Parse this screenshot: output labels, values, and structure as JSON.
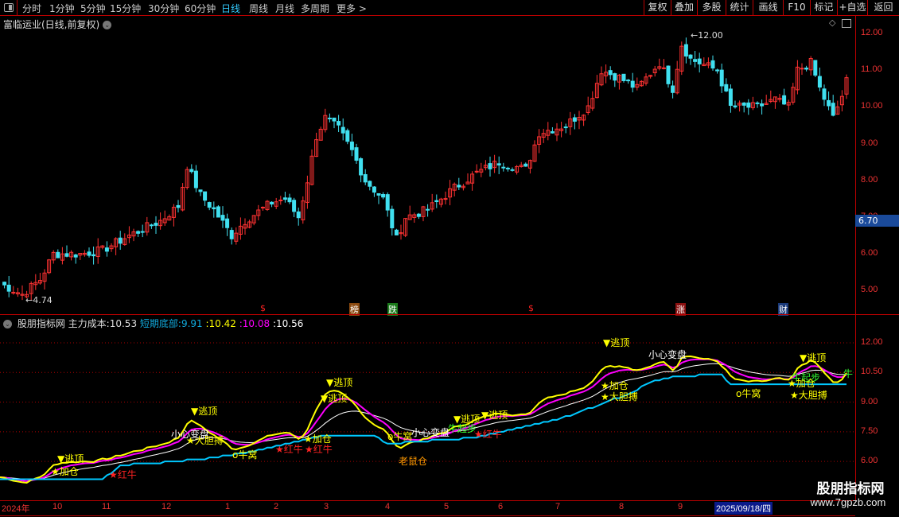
{
  "toolbar": {
    "periods": [
      "分时",
      "1分钟",
      "5分钟",
      "15分钟",
      "30分钟",
      "60分钟",
      "日线",
      "周线",
      "月线",
      "多周期",
      "更多 >"
    ],
    "active_period": "日线",
    "buttons": [
      "复权",
      "叠加",
      "多股",
      "统计",
      "画线",
      "F10",
      "标记",
      "+自选",
      "返回"
    ]
  },
  "main": {
    "title": "富临运业(日线,前复权)",
    "price_ticks": [
      "12.00",
      "11.00",
      "10.00",
      "9.00",
      "8.00",
      "7.00",
      "6.00",
      "5.00"
    ],
    "current_price": "6.70",
    "high_label": "12.00",
    "low_label": "4.74",
    "event_markers": [
      "$",
      "榜",
      "跌",
      "$",
      "涨",
      "财"
    ]
  },
  "indicator": {
    "name": "股朋指标网",
    "main_cost_label": "主力成本:",
    "main_cost": "10.53",
    "short_bottom_label": "短期底部:",
    "short_bottom": "9.91",
    "v_yellow": "10.42",
    "v_magenta": "10.08",
    "v_white": "10.56",
    "ticks": [
      "12.00",
      "10.50",
      "9.00",
      "7.50",
      "6.00"
    ],
    "signals": [
      "▼逃顶",
      "★加仓",
      "★红牛",
      "▼逃顶",
      "小心变盘",
      "★大胆搏",
      "o牛窝",
      "★红牛",
      "★红牛",
      "★加仓",
      "▼逃顶",
      "▼逃顶",
      "老鼠仓",
      "o牛窝",
      "小心变盘",
      "牛起步",
      "★红牛",
      "▼逃顶",
      "▼逃顶",
      "▼逃顶",
      "★加仓",
      "★大胆搏",
      "小心变盘",
      "o牛窝",
      "▼逃顶",
      "牛起步",
      "★加仓",
      "★大胆搏",
      "牛"
    ]
  },
  "dates": [
    "2024年",
    "10",
    "11",
    "12",
    "1",
    "2",
    "3",
    "4",
    "5",
    "6",
    "7",
    "8",
    "9",
    "2025/09/18/四"
  ],
  "watermark": {
    "name": "股朋指标网",
    "url": "www.7gpzb.com"
  },
  "colors": {
    "up": "#ff3232",
    "down": "#40e0f0",
    "yellow": "#ffff00",
    "magenta": "#ff00ff",
    "white": "#ffffff",
    "cyan": "#00c8ff"
  },
  "chart_data": {
    "type": "candlestick",
    "days": 190,
    "close_keyframes": [
      [
        0,
        5.2
      ],
      [
        5,
        4.9
      ],
      [
        9,
        5.3
      ],
      [
        12,
        6.0
      ],
      [
        18,
        6.0
      ],
      [
        23,
        6.1
      ],
      [
        29,
        6.5
      ],
      [
        36,
        6.9
      ],
      [
        40,
        7.3
      ],
      [
        42,
        8.4
      ],
      [
        45,
        7.6
      ],
      [
        48,
        7.2
      ],
      [
        52,
        6.5
      ],
      [
        55,
        6.9
      ],
      [
        61,
        7.4
      ],
      [
        64,
        7.5
      ],
      [
        67,
        7.0
      ],
      [
        69,
        8.0
      ],
      [
        71,
        9.2
      ],
      [
        73,
        9.7
      ],
      [
        76,
        9.4
      ],
      [
        79,
        8.8
      ],
      [
        82,
        8.0
      ],
      [
        86,
        7.5
      ],
      [
        89,
        6.4
      ],
      [
        91,
        7.0
      ],
      [
        96,
        7.2
      ],
      [
        102,
        7.8
      ],
      [
        107,
        8.2
      ],
      [
        112,
        8.5
      ],
      [
        118,
        8.3
      ],
      [
        121,
        9.3
      ],
      [
        127,
        9.5
      ],
      [
        132,
        10.0
      ],
      [
        135,
        11.0
      ],
      [
        139,
        10.8
      ],
      [
        143,
        10.5
      ],
      [
        148,
        11.2
      ],
      [
        151,
        10.5
      ],
      [
        153,
        11.7
      ],
      [
        155,
        11.3
      ],
      [
        161,
        11.0
      ],
      [
        164,
        10.0
      ],
      [
        170,
        10.0
      ],
      [
        174,
        10.2
      ],
      [
        177,
        10.0
      ],
      [
        179,
        11.0
      ],
      [
        182,
        11.2
      ],
      [
        184,
        10.5
      ],
      [
        187,
        9.7
      ],
      [
        189,
        10.3
      ],
      [
        190,
        10.7
      ]
    ],
    "cost_keyframes": [
      [
        0,
        5.07
      ],
      [
        23,
        5.07
      ],
      [
        27,
        5.8
      ],
      [
        45,
        6.1
      ],
      [
        54,
        6.4
      ],
      [
        73,
        7.3
      ],
      [
        84,
        7.3
      ],
      [
        87,
        6.9
      ],
      [
        107,
        7.2
      ],
      [
        116,
        7.7
      ],
      [
        123,
        8.0
      ],
      [
        129,
        8.4
      ],
      [
        136,
        9.0
      ],
      [
        141,
        9.4
      ],
      [
        146,
        10.0
      ],
      [
        152,
        10.3
      ],
      [
        162,
        10.4
      ],
      [
        164,
        9.85
      ],
      [
        190,
        9.85
      ]
    ]
  }
}
